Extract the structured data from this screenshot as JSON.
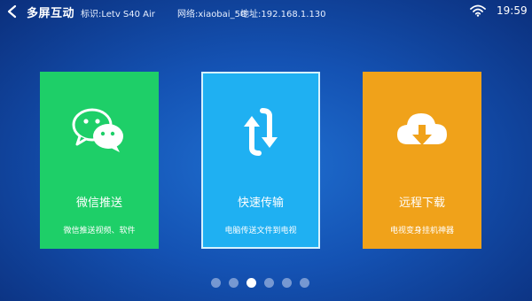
{
  "header": {
    "title": "多屏互动",
    "device_id": "标识:Letv S40 Air",
    "network": "网络:xiaobai_5G",
    "address": "地址:192.168.1.130"
  },
  "status": {
    "time": "19:59",
    "wifi_icon": "wifi-icon"
  },
  "cards": [
    {
      "title": "微信推送",
      "subtitle": "微信推送视频、软件",
      "icon": "wechat-icon",
      "color": "#1ecf68"
    },
    {
      "title": "快速传输",
      "subtitle": "电脑传送文件到电视",
      "icon": "sync-arrows-icon",
      "color": "#1fb0f2",
      "selected": true
    },
    {
      "title": "远程下载",
      "subtitle": "电视变身挂机神器",
      "icon": "cloud-download-icon",
      "color": "#f0a21a"
    }
  ],
  "pagination": {
    "total": 6,
    "current": 3
  },
  "colors": {
    "background": "#1452b3",
    "green": "#1ecf68",
    "blue": "#1fb0f2",
    "orange": "#f0a21a"
  }
}
